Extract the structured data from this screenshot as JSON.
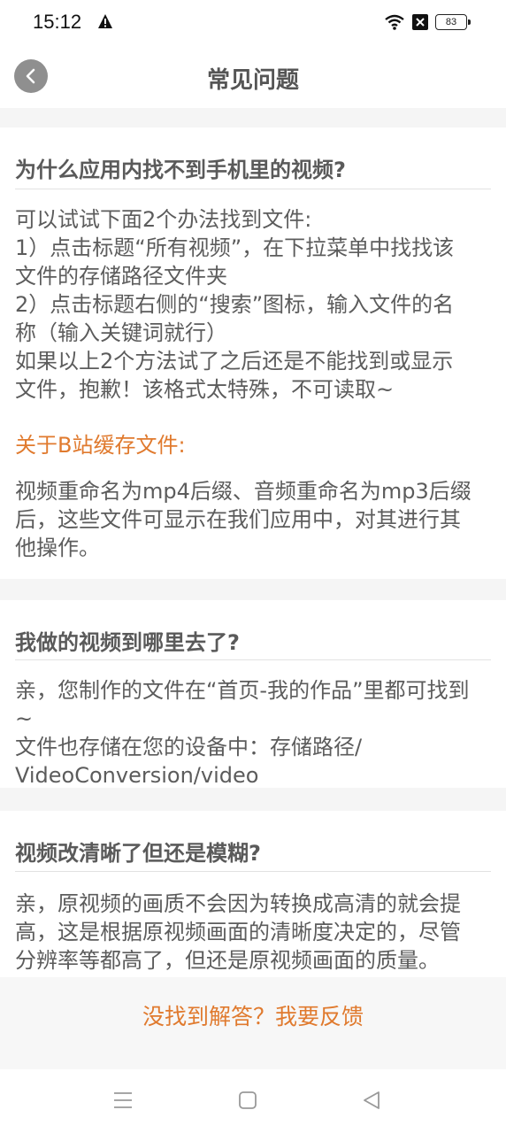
{
  "status_bar": {
    "time": "15:12",
    "battery": "83",
    "icons": [
      "warning-icon",
      "wifi-icon",
      "close-box-icon",
      "battery-icon"
    ]
  },
  "header": {
    "title": "常见问题",
    "back_icon": "chevron-left-icon"
  },
  "faq": [
    {
      "question": "为什么应用内找不到手机里的视频?",
      "answer_lines": [
        "可以试试下面2个办法找到文件:",
        " 1）点击标题“所有视频”，在下拉菜单中找找该",
        "文件的存储路径文件夹",
        " 2）点击标题右侧的“搜索”图标，输入文件的名",
        "称（输入关键词就行）",
        " 如果以上2个方法试了之后还是不能找到或显示",
        "文件，抱歉！该格式太特殊，不可读取~"
      ],
      "subheading": "关于B站缓存文件:",
      "sub_lines": [
        "视频重命名为mp4后缀、音频重命名为mp3后缀",
        "后，这些文件可显示在我们应用中，对其进行其",
        "他操作。"
      ]
    },
    {
      "question": "我做的视频到哪里去了?",
      "answer_lines": [
        "亲，您制作的文件在“首页-我的作品”里都可找到",
        "~",
        " 文件也存储在您的设备中：存储路径/",
        "VideoConversion/video"
      ]
    },
    {
      "question": "视频改清晰了但还是模糊?",
      "answer_lines": [
        "亲，原视频的画质不会因为转换成高清的就会提",
        "高，这是根据原视频画面的清晰度决定的，尽管",
        "分辨率等都高了，但还是原视频画面的质量。"
      ]
    }
  ],
  "feedback": {
    "label": "没找到解答？我要反馈"
  },
  "nav_bar": {
    "icons": [
      "menu-icon",
      "home-icon",
      "back-triangle-icon"
    ]
  },
  "colors": {
    "accent": "#e07a2e",
    "text": "#5c5c5c",
    "separator_bg": "#f5f5f5"
  }
}
